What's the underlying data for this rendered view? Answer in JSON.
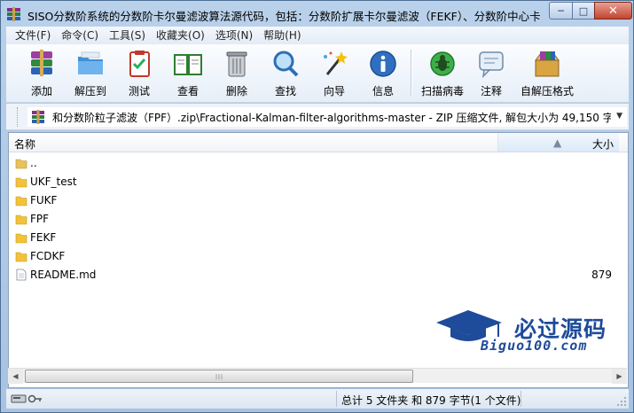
{
  "window": {
    "title": "SISO分数阶系统的分数阶卡尔曼滤波算法源代码，包括：分数阶扩展卡尔曼滤波（FEKF）、分数阶中心卡...",
    "minimize_label": "─",
    "maximize_label": "□",
    "close_label": "✕"
  },
  "menu": [
    "文件(F)",
    "命令(C)",
    "工具(S)",
    "收藏夹(O)",
    "选项(N)",
    "帮助(H)"
  ],
  "toolbar": {
    "add": "添加",
    "extract": "解压到",
    "test": "测试",
    "view": "查看",
    "delete": "删除",
    "find": "查找",
    "wizard": "向导",
    "info": "信息",
    "virus_scan": "扫描病毒",
    "comment": "注释",
    "sfx": "自解压格式"
  },
  "address": {
    "path": "和分数阶粒子滤波（FPF）.zip\\Fractional-Kalman-filter-algorithms-master - ZIP 压缩文件, 解包大小为 49,150 字节"
  },
  "columns": {
    "name": "名称",
    "size": "大小"
  },
  "files": [
    {
      "name": "..",
      "size": "",
      "type": "up"
    },
    {
      "name": "UKF_test",
      "size": "",
      "type": "folder"
    },
    {
      "name": "FUKF",
      "size": "",
      "type": "folder"
    },
    {
      "name": "FPF",
      "size": "",
      "type": "folder"
    },
    {
      "name": "FEKF",
      "size": "",
      "type": "folder"
    },
    {
      "name": "FCDKF",
      "size": "",
      "type": "folder"
    },
    {
      "name": "README.md",
      "size": "879",
      "type": "file"
    }
  ],
  "watermark": {
    "title": "必过源码",
    "subtitle": "Biguo100.com"
  },
  "status": {
    "summary": "总计 5 文件夹 和 879 字节(1 个文件)"
  },
  "colors": {
    "folder": "#f2c33a",
    "accent": "#1e4b9a",
    "titlebar": "#b9d1ea"
  }
}
